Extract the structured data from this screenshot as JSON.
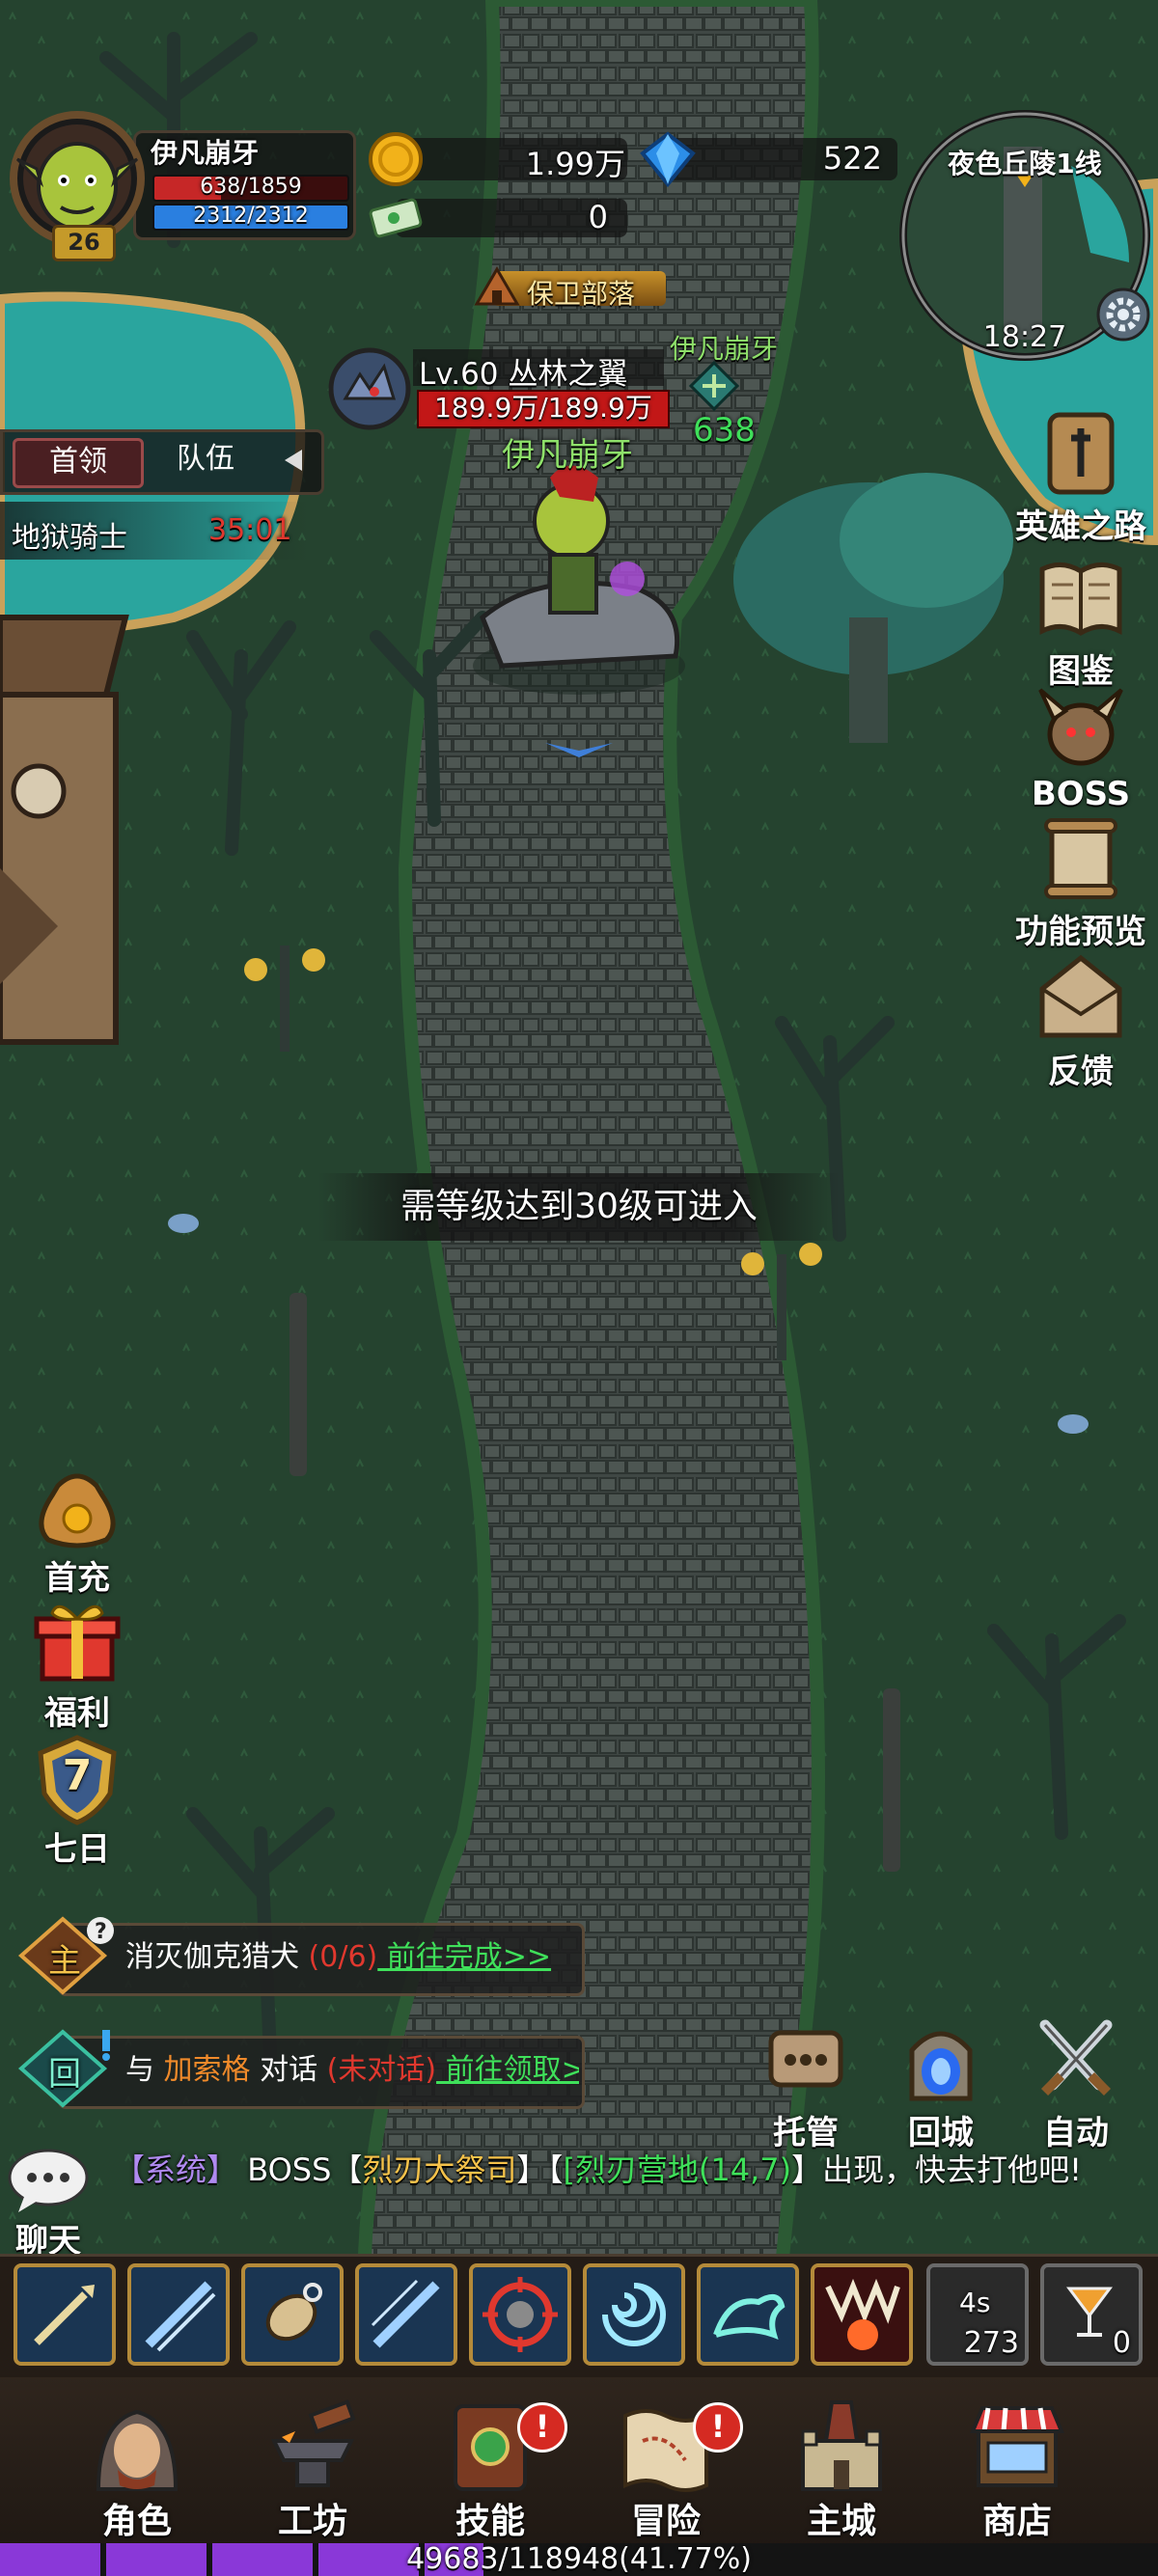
{
  "player": {
    "name": "伊凡崩牙",
    "level": "26",
    "hp": "638/1859",
    "hp_fraction": 0.343,
    "mp": "2312/2312",
    "mp_fraction": 1.0
  },
  "currency": {
    "gold": "1.99万",
    "diamonds": "522",
    "tickets": "0"
  },
  "minimap": {
    "location": "夜色丘陵1线",
    "time": "18:27"
  },
  "tribe_banner": "保卫部落",
  "target": {
    "level_name": "Lv.60 丛林之翼",
    "hp": "189.9万/189.9万"
  },
  "ally": {
    "name": "伊凡崩牙",
    "value": "638"
  },
  "character_name": "伊凡崩牙",
  "tabs": {
    "boss": "首领",
    "team": "队伍"
  },
  "boss_timer": {
    "name": "地狱骑士",
    "time": "35:01"
  },
  "right_menu": [
    {
      "label": "英雄之路",
      "icon": "hero-path-icon"
    },
    {
      "label": "图鉴",
      "icon": "book-icon"
    },
    {
      "label": "BOSS",
      "icon": "boss-icon"
    },
    {
      "label": "功能预览",
      "icon": "scroll-preview-icon"
    },
    {
      "label": "反馈",
      "icon": "envelope-icon"
    }
  ],
  "left_menu": [
    {
      "label": "首充",
      "icon": "money-bag-icon"
    },
    {
      "label": "福利",
      "icon": "gift-icon"
    },
    {
      "label": "七日",
      "icon": "seven-day-shield-icon",
      "number": "7"
    }
  ],
  "notice": "需等级达到30级可进入",
  "quests": [
    {
      "tag": "主",
      "parts": [
        "消灭伽克猎犬 ",
        "(0/6)",
        " 前往完成>>"
      ]
    },
    {
      "tag": "回",
      "parts": [
        "与 ",
        "加索格",
        " 对话 ",
        "(未对话)",
        " 前往领取>>"
      ]
    }
  ],
  "actions": {
    "auto_manage": "托管",
    "return_city": "回城",
    "auto": "自动"
  },
  "chat": {
    "label": "聊天",
    "system_tag": "【系统】",
    "pre": " BOSS【",
    "boss": "烈刃大祭司",
    "mid": "】【",
    "place": "[烈刃营地(14,7)",
    "post": "】出现，快去打他吧!"
  },
  "skills": {
    "cooldown": "4s",
    "cooldown_count": "273",
    "potion_count": "0"
  },
  "bottom_nav": [
    {
      "label": "角色",
      "icon": "character-icon",
      "badge": false
    },
    {
      "label": "工坊",
      "icon": "anvil-icon",
      "badge": false
    },
    {
      "label": "技能",
      "icon": "skill-book-icon",
      "badge": true
    },
    {
      "label": "冒险",
      "icon": "adventure-map-icon",
      "badge": true
    },
    {
      "label": "主城",
      "icon": "castle-icon",
      "badge": false
    },
    {
      "label": "商店",
      "icon": "shop-icon",
      "badge": false
    }
  ],
  "exp": {
    "text": "49683/118948(41.77%)",
    "fraction": 0.4177
  }
}
